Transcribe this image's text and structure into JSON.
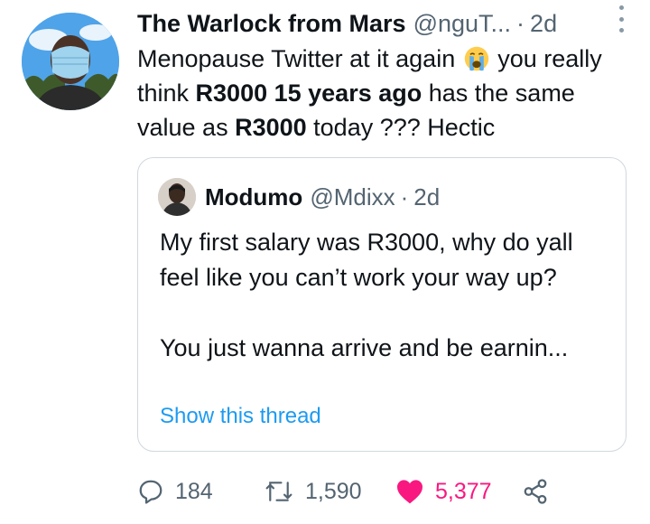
{
  "author": {
    "display_name": "The Warlock from Mars",
    "handle": "@nguT...",
    "separator": "·",
    "time": "2d"
  },
  "icons": {
    "more": "more-vertical-icon",
    "emoji": "loudly-crying-face-emoji",
    "reply": "reply-icon",
    "retweet": "retweet-icon",
    "like": "heart-icon",
    "share": "share-icon"
  },
  "tweet_text": {
    "part1": "Menopause Twitter at it again ",
    "part2": " you really think ",
    "bold1": "R3000 15 years ago",
    "part3": " has the same value as ",
    "bold2": "R3000",
    "part4": " today ??? Hectic"
  },
  "quoted": {
    "display_name": "Modumo",
    "handle": "@Mdixx",
    "separator": "·",
    "time": "2d",
    "paragraph1": "My first salary was R3000, why do yall feel like you can’t work your way up?",
    "paragraph2": "You just wanna arrive and be earnin...",
    "show_thread": "Show this thread"
  },
  "stats": {
    "replies": "184",
    "retweets": "1,590",
    "likes": "5,377"
  },
  "colors": {
    "text": "#0f1419",
    "muted": "#536471",
    "link": "#1d9bf0",
    "like": "#f91880",
    "border": "#cfd9de"
  }
}
